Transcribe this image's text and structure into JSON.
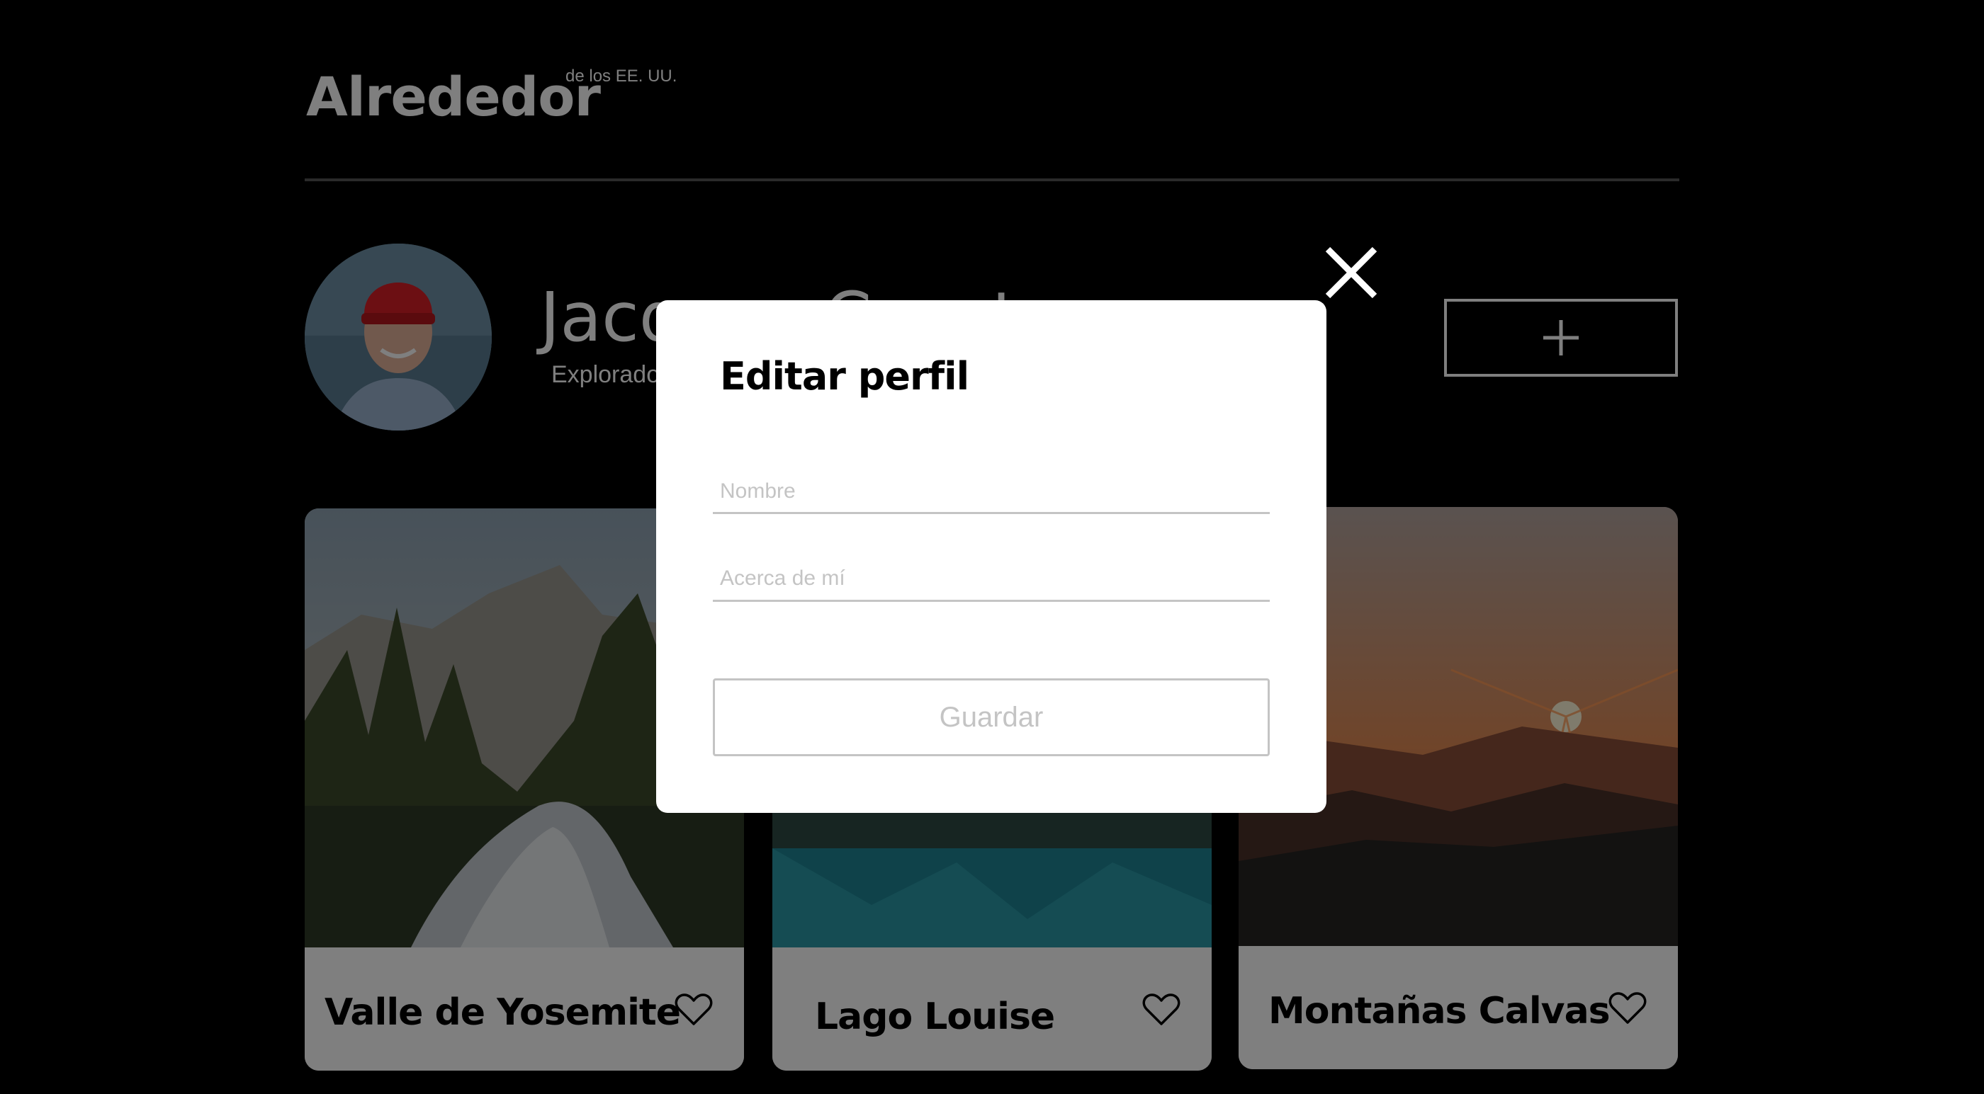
{
  "header": {
    "logo_main": "Alrededor",
    "logo_sup": "de los EE. UU."
  },
  "profile": {
    "name": "Jacques Cousteau",
    "about": "Explorador"
  },
  "cards": [
    {
      "title": "Valle de Yosemite",
      "like_icon": "heart-icon"
    },
    {
      "title": "Lago Louise",
      "like_icon": "heart-icon"
    },
    {
      "title": "Montañas Calvas",
      "like_icon": "heart-icon"
    }
  ],
  "modal": {
    "title": "Editar perfil",
    "name_placeholder": "Nombre",
    "about_placeholder": "Acerca de mí",
    "save_label": "Guardar",
    "close_icon": "close-icon"
  },
  "colors": {
    "background": "#000000",
    "overlay": "rgba(0,0,0,0.5)",
    "modal_bg": "#ffffff",
    "disabled": "#c4c4c4"
  }
}
